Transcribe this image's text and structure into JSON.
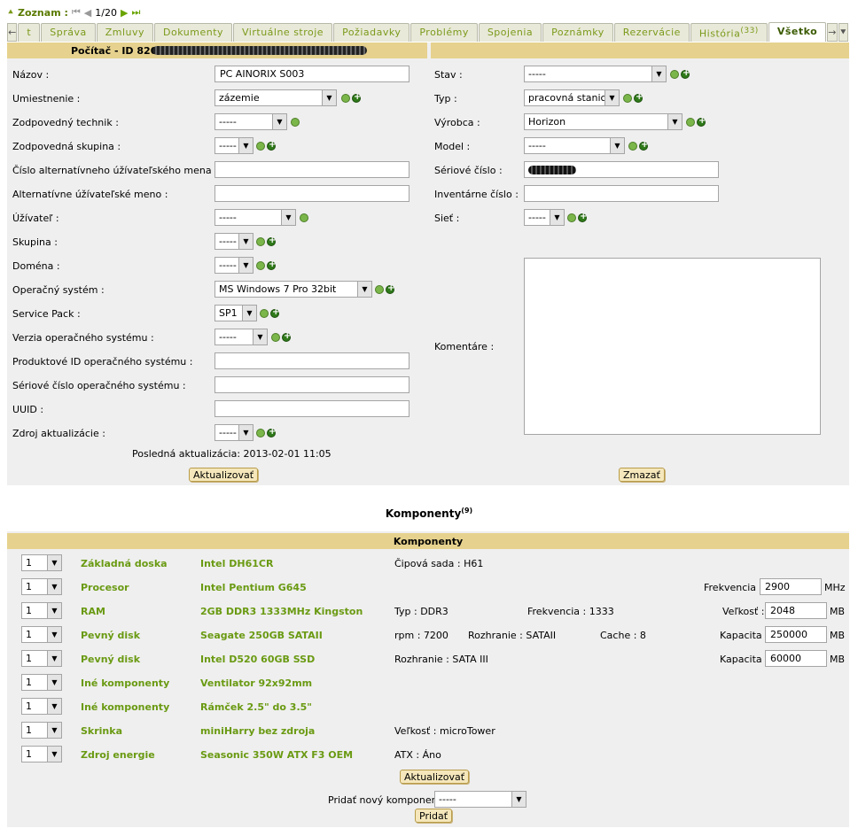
{
  "topnav": {
    "zoznam": "Zoznam :",
    "counter": "1/20"
  },
  "tabs": [
    {
      "label": "t"
    },
    {
      "label": "Správa"
    },
    {
      "label": "Zmluvy"
    },
    {
      "label": "Dokumenty"
    },
    {
      "label": "Virtuálne stroje"
    },
    {
      "label": "Požiadavky"
    },
    {
      "label": "Problémy"
    },
    {
      "label": "Spojenia"
    },
    {
      "label": "Poznámky"
    },
    {
      "label": "Rezervácie"
    },
    {
      "label": "História",
      "count": "(33)"
    },
    {
      "label": "Všetko"
    }
  ],
  "form": {
    "title": "Počítač - ID 820",
    "left": {
      "nazov": {
        "label": "Názov :",
        "value": "PC AINORIX S003"
      },
      "umiestnenie": {
        "label": "Umiestnenie :",
        "value": "zázemie"
      },
      "technik": {
        "label": "Zodpovedný technik :",
        "value": "-----"
      },
      "skupina_zodp": {
        "label": "Zodpovedná skupina :",
        "value": "-----"
      },
      "alt_cislo": {
        "label": "Číslo alternatívneho úžívateľského mena :",
        "value": ""
      },
      "alt_meno": {
        "label": "Alternatívne úžívateľské meno :",
        "value": ""
      },
      "uzivatel": {
        "label": "Úžívateľ :",
        "value": "-----"
      },
      "skupina": {
        "label": "Skupina :",
        "value": "-----"
      },
      "domena": {
        "label": "Doména :",
        "value": "-----"
      },
      "os": {
        "label": "Operačný systém :",
        "value": "MS Windows 7 Pro 32bit"
      },
      "sp": {
        "label": "Service Pack :",
        "value": "SP1"
      },
      "os_verzia": {
        "label": "Verzia operačného systému :",
        "value": "-----"
      },
      "os_prod_id": {
        "label": "Produktové ID operačného systému :",
        "value": ""
      },
      "os_serial": {
        "label": "Sériové číslo operačného systému :",
        "value": ""
      },
      "uuid": {
        "label": "UUID :",
        "value": ""
      },
      "zdroj": {
        "label": "Zdroj aktualizácie :",
        "value": "-----"
      },
      "last_update": "Posledná aktualizácia: 2013-02-01 11:05",
      "update_button": "Aktualizovať"
    },
    "right": {
      "stav": {
        "label": "Stav :",
        "value": "-----"
      },
      "typ": {
        "label": "Typ :",
        "value": "pracovná stanica"
      },
      "vyrobca": {
        "label": "Výrobca :",
        "value": "Horizon"
      },
      "model": {
        "label": "Model :",
        "value": "-----"
      },
      "seriove": {
        "label": "Sériové číslo :"
      },
      "inventarne": {
        "label": "Inventárne číslo :",
        "value": ""
      },
      "siet": {
        "label": "Sieť :",
        "value": "-----"
      },
      "komentare": {
        "label": "Komentáre :"
      },
      "delete_button": "Zmazať"
    }
  },
  "components": {
    "title": "Komponenty",
    "count": "(9)",
    "header": "Komponenty",
    "rows": [
      {
        "qty": "1",
        "type": "Základná doska",
        "name": "Intel DH61CR",
        "props": [
          "Čipová sada : H61"
        ]
      },
      {
        "qty": "1",
        "type": "Procesor",
        "name": "Intel Pentium G645",
        "field_label": "Frekvencia :",
        "field_value": "2900",
        "unit": "MHz"
      },
      {
        "qty": "1",
        "type": "RAM",
        "name": "2GB DDR3 1333MHz Kingston",
        "props": [
          "Typ : DDR3",
          "Frekvencia : 1333"
        ],
        "field_label": "Veľkosť :",
        "field_value": "2048",
        "unit": "MB"
      },
      {
        "qty": "1",
        "type": "Pevný disk",
        "name": "Seagate 250GB SATAII",
        "props": [
          "rpm : 7200",
          "Rozhranie : SATAII",
          "Cache : 8"
        ],
        "field_label": "Kapacita :",
        "field_value": "250000",
        "unit": "MB"
      },
      {
        "qty": "1",
        "type": "Pevný disk",
        "name": "Intel D520 60GB SSD",
        "props": [
          "Rozhranie : SATA III"
        ],
        "field_label": "Kapacita :",
        "field_value": "60000",
        "unit": "MB"
      },
      {
        "qty": "1",
        "type": "Iné komponenty",
        "name": "Ventilator 92x92mm"
      },
      {
        "qty": "1",
        "type": "Iné komponenty",
        "name": "Rámček 2.5\" do 3.5\""
      },
      {
        "qty": "1",
        "type": "Skrinka",
        "name": "miniHarry bez zdroja",
        "props": [
          "Veľkosť : microTower"
        ]
      },
      {
        "qty": "1",
        "type": "Zdroj energie",
        "name": "Seasonic 350W ATX F3 OEM",
        "props": [
          "ATX : Áno"
        ]
      }
    ],
    "update_button": "Aktualizovať",
    "add_label": "Pridať nový komponent :",
    "add_select": "-----",
    "add_button": "Pridať"
  }
}
